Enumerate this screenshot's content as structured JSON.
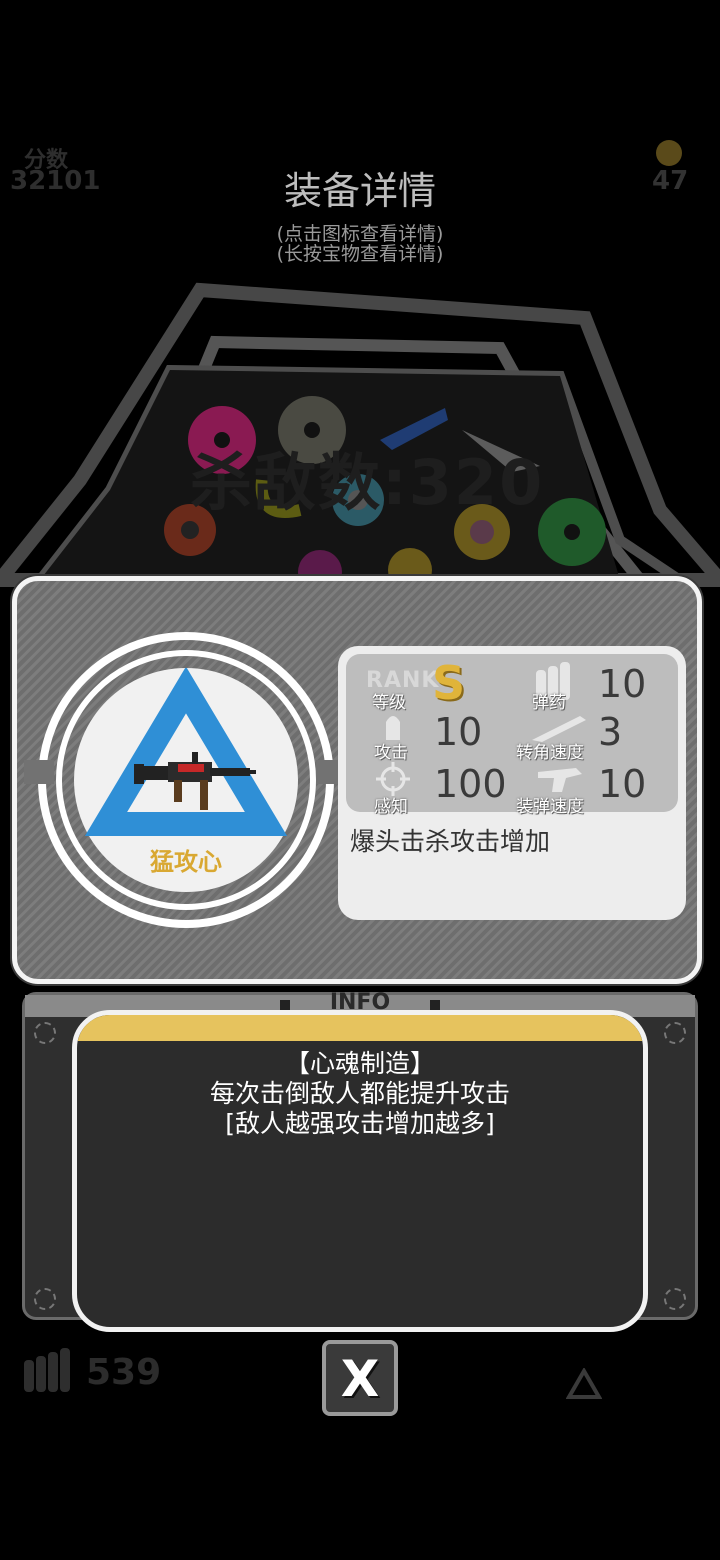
{
  "background": {
    "score_label": "分数",
    "score_value": "32101",
    "coin_value": "47",
    "kills_text": "杀敌数:320",
    "ammo_count": "539"
  },
  "modal": {
    "title": "装备详情",
    "hint_1": "(点击图标查看详情)",
    "hint_2": "(长按宝物查看详情)"
  },
  "item": {
    "name": "猛攻心",
    "icon": "machine-gun-icon",
    "rank_word": "RANK",
    "rank_label": "等级",
    "rank_value": "S",
    "stats": {
      "ammo_label": "弹药",
      "ammo_value": "10",
      "attack_label": "攻击",
      "attack_value": "10",
      "turn_speed_label": "转角速度",
      "turn_speed_value": "3",
      "perception_label": "感知",
      "perception_value": "100",
      "reload_speed_label": "装弹速度",
      "reload_speed_value": "10"
    },
    "description": "爆头击杀攻击增加"
  },
  "info": {
    "header": "INFO",
    "skill_name": "【心魂制造】",
    "skill_line_1": "每次击倒敌人都能提升攻击",
    "skill_line_2": "[敌人越强攻击增加越多]"
  },
  "close_label": "X",
  "colors": {
    "rank_gold": "#e0b43a",
    "item_triangle": "#2f8fd6",
    "info_accent": "#e6c35e"
  }
}
